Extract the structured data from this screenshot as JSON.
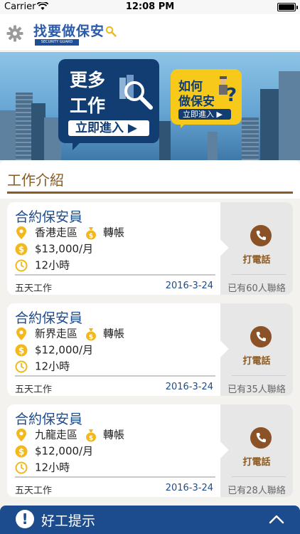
{
  "status_bar": {
    "carrier": "Carrier",
    "time": "12:08 PM"
  },
  "header": {
    "logo_text_main": "找要做保安",
    "logo_text_sub": "SECURITY GUARD"
  },
  "banner": {
    "promo_jobs": {
      "line1": "更多",
      "line2": "工作",
      "button": "立即進入 ▶"
    },
    "promo_howto": {
      "line1": "如何",
      "line2": "做保安",
      "button": "立即進入 ▶"
    }
  },
  "section": {
    "title": "工作介紹"
  },
  "jobs": [
    {
      "title": "合約保安員",
      "region": "香港走區",
      "payment": "轉帳",
      "salary": "$13,000/月",
      "hours": "12小時",
      "days": "五天工作",
      "date": "2016-3-24",
      "call_label": "打電話",
      "contacts": "已有60人聯絡"
    },
    {
      "title": "合約保安員",
      "region": "新界走區",
      "payment": "轉帳",
      "salary": "$12,000/月",
      "hours": "12小時",
      "days": "五天工作",
      "date": "2016-3-24",
      "call_label": "打電話",
      "contacts": "已有35人聯絡"
    },
    {
      "title": "合約保安員",
      "region": "九龍走區",
      "payment": "轉帳",
      "salary": "$12,000/月",
      "hours": "12小時",
      "days": "五天工作",
      "date": "2016-3-24",
      "call_label": "打電話",
      "contacts": "已有28人聯絡"
    }
  ],
  "tip_bar": {
    "label": "好工提示"
  },
  "colors": {
    "primary_blue": "#1c4c8e",
    "brown": "#8a5a24",
    "yellow": "#f6c91b"
  },
  "icons": [
    "wifi-icon",
    "battery-icon",
    "gear-icon",
    "search-icon",
    "location-pin-icon",
    "money-bag-icon",
    "dollar-coin-icon",
    "clock-icon",
    "phone-icon",
    "exclamation-icon",
    "chevron-up-icon"
  ]
}
